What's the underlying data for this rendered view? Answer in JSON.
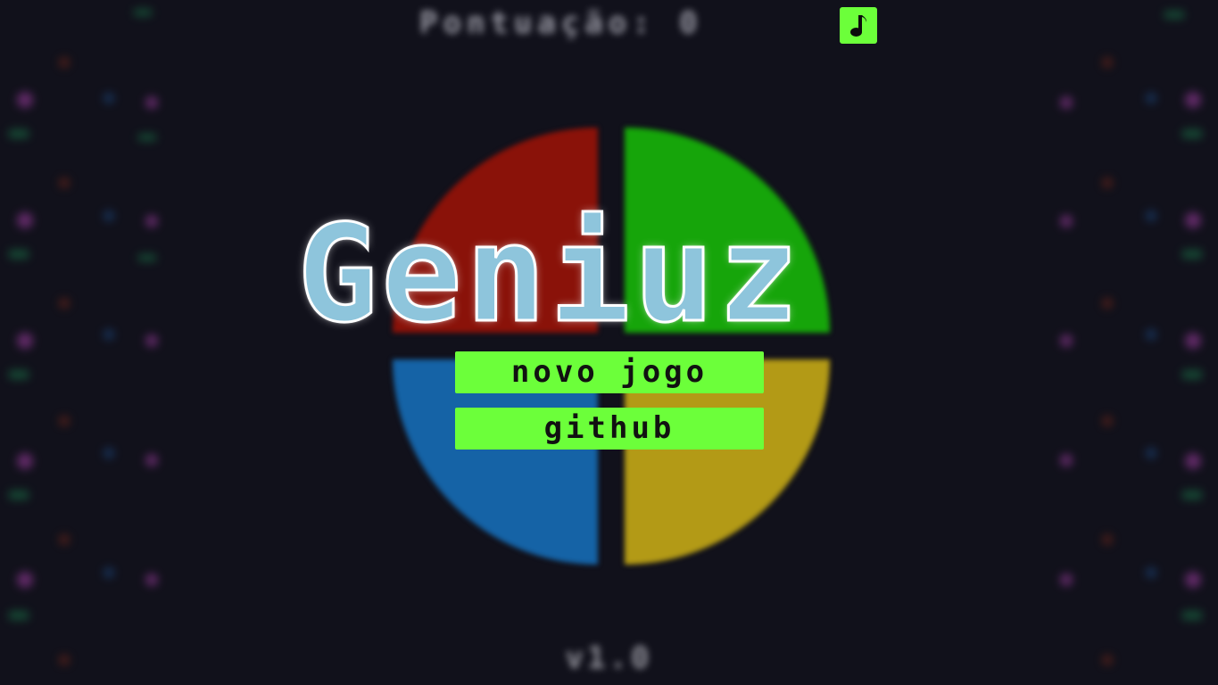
{
  "top_bar": {
    "score_text": "Pontuação: 0",
    "music_icon": "music-note-icon"
  },
  "title": "Geniuz",
  "menu": {
    "new_game_label": "novo jogo",
    "github_label": "github"
  },
  "version": "v1.0",
  "colors": {
    "background": "#11111b",
    "accent_green": "#6cff3a",
    "title_fill": "#8ec5dc",
    "quad_red": "#8a1209",
    "quad_green": "#16a50a",
    "quad_blue": "#1563a6",
    "quad_yellow": "#b39a16"
  }
}
